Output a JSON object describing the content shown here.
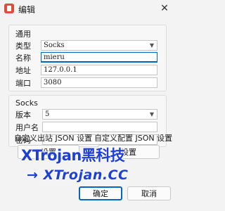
{
  "window": {
    "title": "编辑",
    "close_glyph": "✕"
  },
  "general": {
    "title": "通用",
    "type_label": "类型",
    "type_value": "Socks",
    "name_label": "名称",
    "name_value": "mieru",
    "address_label": "地址",
    "address_value": "127.0.0.1",
    "port_label": "端口",
    "port_value": "3080"
  },
  "socks": {
    "title": "Socks",
    "version_label": "版本",
    "version_value": "5",
    "username_label": "用户名",
    "username_value": "",
    "password_label": "密码",
    "password_value": ""
  },
  "outbound_json": {
    "label": "自定义出站 JSON 设置",
    "button": "设置"
  },
  "config_json": {
    "label": "自定义配置 JSON 设置",
    "button": "设置"
  },
  "footer": {
    "ok": "确定",
    "cancel": "取消"
  },
  "watermark": {
    "line1": "XTrojan黑科技",
    "line2": "→ XTrojan.CC"
  },
  "colors": {
    "accent": "#0067c0",
    "watermark": "#1e3fd8",
    "app_icon": "#e04b3a"
  },
  "icons": {
    "app": "edit-app-icon",
    "close": "close-icon",
    "dropdown": "chevron-down-icon"
  }
}
